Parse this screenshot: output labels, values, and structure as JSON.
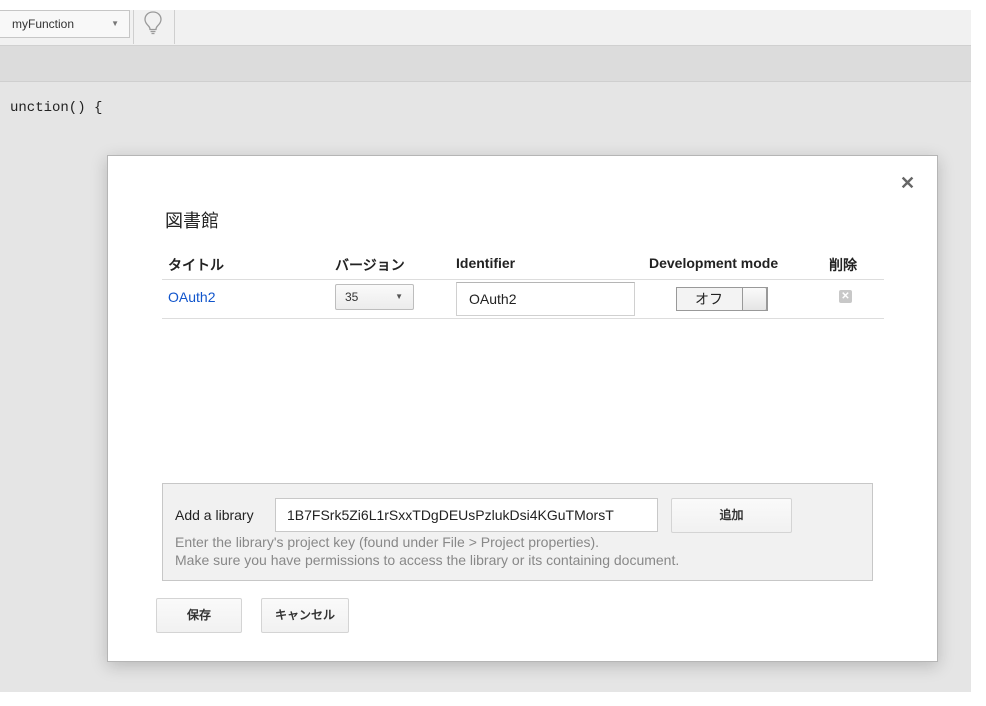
{
  "toolbar": {
    "function_select": "myFunction",
    "lightbulb_icon": "lightbulb-icon"
  },
  "editor": {
    "code_line": "unction() {"
  },
  "dialog": {
    "title": "図書館",
    "close_icon": "close-icon",
    "table": {
      "headers": {
        "title": "タイトル",
        "version": "バージョン",
        "identifier": "Identifier",
        "dev_mode": "Development mode",
        "delete": "削除"
      },
      "rows": [
        {
          "title": "OAuth2",
          "version": "35",
          "identifier": "OAuth2",
          "dev_mode": "オフ"
        }
      ]
    },
    "add_library": {
      "label": "Add a library",
      "value": "1B7FSrk5Zi6L1rSxxTDgDEUsPzlukDsi4KGuTMorsT",
      "button": "追加",
      "hint_line1": "Enter the library's project key (found under File > Project properties).",
      "hint_line2": "Make sure you have permissions to access the library or its containing document."
    },
    "buttons": {
      "save": "保存",
      "cancel": "キャンセル"
    }
  }
}
